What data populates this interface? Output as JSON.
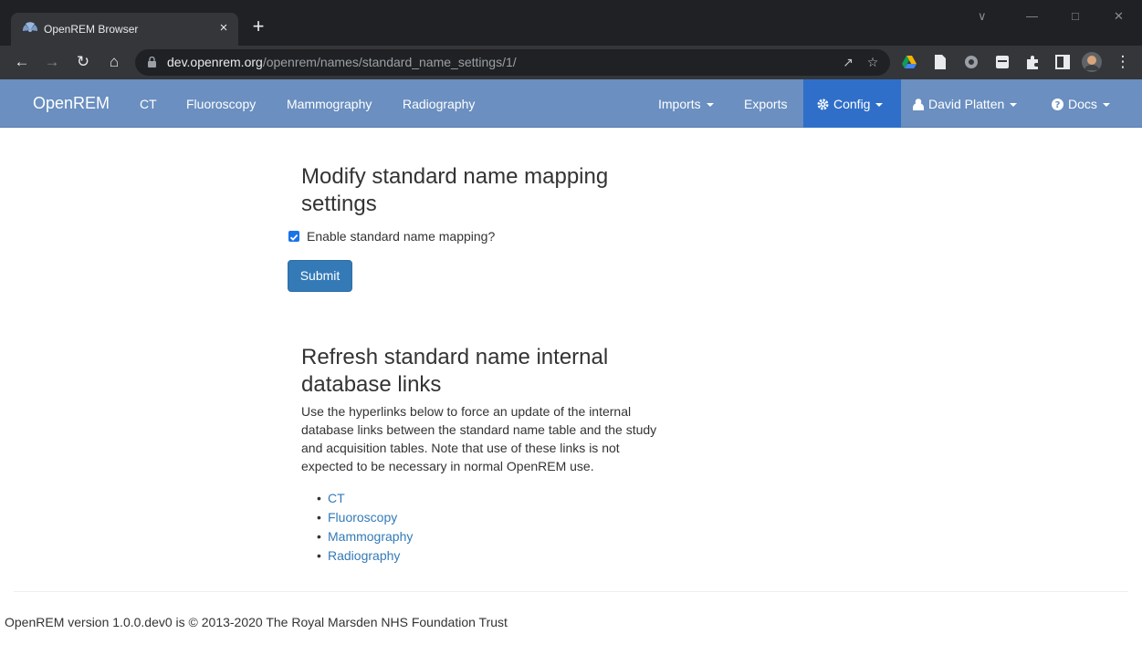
{
  "browser": {
    "tab_title": "OpenREM Browser",
    "tab_close": "×",
    "new_tab": "+",
    "url_host": "dev.openrem.org",
    "url_path": "/openrem/names/standard_name_settings/1/",
    "window_controls": [
      "∨",
      "—",
      "□",
      "✕"
    ]
  },
  "navbar": {
    "brand": "OpenREM",
    "links": [
      "CT",
      "Fluoroscopy",
      "Mammography",
      "Radiography"
    ],
    "imports": "Imports",
    "exports": "Exports",
    "config": "Config",
    "user": "David Platten",
    "docs": "Docs",
    "colors": {
      "bar": "#6a8fc0",
      "active": "#2f6fc9"
    }
  },
  "settings": {
    "heading": "Modify standard name mapping settings",
    "checkbox_label": "Enable standard name mapping?",
    "checkbox_checked": true,
    "submit_label": "Submit"
  },
  "refresh": {
    "heading": "Refresh standard name internal database links",
    "description": "Use the hyperlinks below to force an update of the internal database links between the standard name table and the study and acquisition tables. Note that use of these links is not expected to be necessary in normal OpenREM use.",
    "links": [
      "CT",
      "Fluoroscopy",
      "Mammography",
      "Radiography"
    ]
  },
  "footer": {
    "text": "OpenREM version 1.0.0.dev0 is © 2013-2020 The Royal Marsden NHS Foundation Trust"
  }
}
